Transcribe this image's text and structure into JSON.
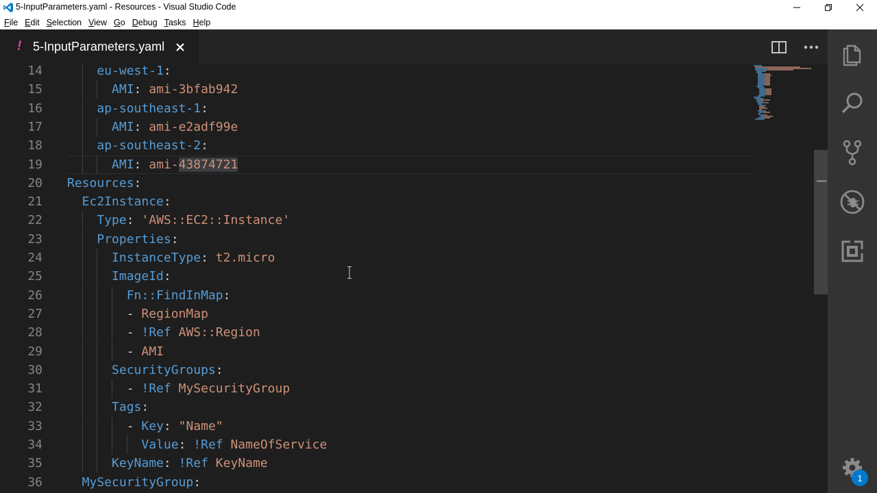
{
  "window": {
    "title": "5-InputParameters.yaml - Resources - Visual Studio Code"
  },
  "menu": [
    {
      "label": "File",
      "u": "F",
      "rest": "ile"
    },
    {
      "label": "Edit",
      "u": "E",
      "rest": "dit"
    },
    {
      "label": "Selection",
      "u": "S",
      "rest": "election"
    },
    {
      "label": "View",
      "u": "V",
      "rest": "iew"
    },
    {
      "label": "Go",
      "u": "G",
      "rest": "o"
    },
    {
      "label": "Debug",
      "u": "D",
      "rest": "ebug"
    },
    {
      "label": "Tasks",
      "u": "T",
      "rest": "asks"
    },
    {
      "label": "Help",
      "u": "H",
      "rest": "elp"
    }
  ],
  "tab": {
    "modified_marker": "!",
    "label": "5-InputParameters.yaml"
  },
  "editor": {
    "lines": [
      {
        "n": "14",
        "indent": 2,
        "tokens": [
          {
            "t": "eu-west-1",
            "c": "k"
          },
          {
            "t": ":",
            "c": "p"
          }
        ]
      },
      {
        "n": "15",
        "indent": 3,
        "tokens": [
          {
            "t": "AMI",
            "c": "k"
          },
          {
            "t": ": ",
            "c": "p"
          },
          {
            "t": "ami-3bfab942",
            "c": "s"
          }
        ]
      },
      {
        "n": "16",
        "indent": 2,
        "tokens": [
          {
            "t": "ap-southeast-1",
            "c": "k"
          },
          {
            "t": ":",
            "c": "p"
          }
        ]
      },
      {
        "n": "17",
        "indent": 3,
        "tokens": [
          {
            "t": "AMI",
            "c": "k"
          },
          {
            "t": ": ",
            "c": "p"
          },
          {
            "t": "ami-e2adf99e",
            "c": "s"
          }
        ]
      },
      {
        "n": "18",
        "indent": 2,
        "tokens": [
          {
            "t": "ap-southeast-2",
            "c": "k"
          },
          {
            "t": ":",
            "c": "p"
          }
        ]
      },
      {
        "n": "19",
        "indent": 3,
        "current": true,
        "tokens": [
          {
            "t": "AMI",
            "c": "k"
          },
          {
            "t": ": ",
            "c": "p"
          },
          {
            "t": "ami-",
            "c": "s"
          },
          {
            "t": "43874721",
            "c": "s sel"
          }
        ]
      },
      {
        "n": "20",
        "indent": 0,
        "tokens": [
          {
            "t": "Resources",
            "c": "k"
          },
          {
            "t": ":",
            "c": "p"
          }
        ]
      },
      {
        "n": "21",
        "indent": 1,
        "tokens": [
          {
            "t": "Ec2Instance",
            "c": "k"
          },
          {
            "t": ":",
            "c": "p"
          }
        ]
      },
      {
        "n": "22",
        "indent": 2,
        "tokens": [
          {
            "t": "Type",
            "c": "k"
          },
          {
            "t": ": ",
            "c": "p"
          },
          {
            "t": "'AWS::EC2::Instance'",
            "c": "s"
          }
        ]
      },
      {
        "n": "23",
        "indent": 2,
        "tokens": [
          {
            "t": "Properties",
            "c": "k"
          },
          {
            "t": ":",
            "c": "p"
          }
        ]
      },
      {
        "n": "24",
        "indent": 3,
        "tokens": [
          {
            "t": "InstanceType",
            "c": "k"
          },
          {
            "t": ": ",
            "c": "p"
          },
          {
            "t": "t2.micro",
            "c": "s"
          }
        ]
      },
      {
        "n": "25",
        "indent": 3,
        "tokens": [
          {
            "t": "ImageId",
            "c": "k"
          },
          {
            "t": ":",
            "c": "p"
          }
        ]
      },
      {
        "n": "26",
        "indent": 4,
        "tokens": [
          {
            "t": "Fn::FindInMap",
            "c": "k"
          },
          {
            "t": ":",
            "c": "p"
          }
        ]
      },
      {
        "n": "27",
        "indent": 4,
        "tokens": [
          {
            "t": "- ",
            "c": "p"
          },
          {
            "t": "RegionMap",
            "c": "s"
          }
        ]
      },
      {
        "n": "28",
        "indent": 4,
        "tokens": [
          {
            "t": "- ",
            "c": "p"
          },
          {
            "t": "!Ref",
            "c": "k"
          },
          {
            "t": " ",
            "c": "p"
          },
          {
            "t": "AWS::Region",
            "c": "s"
          }
        ]
      },
      {
        "n": "29",
        "indent": 4,
        "tokens": [
          {
            "t": "- ",
            "c": "p"
          },
          {
            "t": "AMI",
            "c": "s"
          }
        ]
      },
      {
        "n": "30",
        "indent": 3,
        "tokens": [
          {
            "t": "SecurityGroups",
            "c": "k"
          },
          {
            "t": ":",
            "c": "p"
          }
        ]
      },
      {
        "n": "31",
        "indent": 4,
        "tokens": [
          {
            "t": "- ",
            "c": "p"
          },
          {
            "t": "!Ref",
            "c": "k"
          },
          {
            "t": " ",
            "c": "p"
          },
          {
            "t": "MySecurityGroup",
            "c": "s"
          }
        ]
      },
      {
        "n": "32",
        "indent": 3,
        "tokens": [
          {
            "t": "Tags",
            "c": "k"
          },
          {
            "t": ":",
            "c": "p"
          }
        ]
      },
      {
        "n": "33",
        "indent": 4,
        "tokens": [
          {
            "t": "- ",
            "c": "p"
          },
          {
            "t": "Key",
            "c": "k"
          },
          {
            "t": ": ",
            "c": "p"
          },
          {
            "t": "\"Name\"",
            "c": "s"
          }
        ]
      },
      {
        "n": "34",
        "indent": 5,
        "tokens": [
          {
            "t": "Value",
            "c": "k"
          },
          {
            "t": ": ",
            "c": "p"
          },
          {
            "t": "!Ref",
            "c": "k"
          },
          {
            "t": " ",
            "c": "p"
          },
          {
            "t": "NameOfService",
            "c": "s"
          }
        ]
      },
      {
        "n": "35",
        "indent": 3,
        "tokens": [
          {
            "t": "KeyName",
            "c": "k"
          },
          {
            "t": ": ",
            "c": "p"
          },
          {
            "t": "!Ref",
            "c": "k"
          },
          {
            "t": " ",
            "c": "p"
          },
          {
            "t": "KeyName",
            "c": "s"
          }
        ]
      },
      {
        "n": "36",
        "indent": 1,
        "tokens": [
          {
            "t": "MySecurityGroup",
            "c": "k"
          },
          {
            "t": ":",
            "c": "p"
          }
        ]
      }
    ]
  },
  "activity": [
    {
      "name": "explorer-icon"
    },
    {
      "name": "search-icon"
    },
    {
      "name": "source-control-icon"
    },
    {
      "name": "debug-icon"
    },
    {
      "name": "extensions-icon"
    },
    {
      "name": "manage-gear-icon"
    }
  ],
  "badge": {
    "count": "1"
  },
  "colors": {
    "editor_bg": "#1e1e1e",
    "keyword": "#569cd6",
    "string": "#ce9178",
    "line_number": "#858585",
    "activity_bar": "#333333",
    "modified_marker": "#e2449a",
    "accent": "#007acc"
  }
}
